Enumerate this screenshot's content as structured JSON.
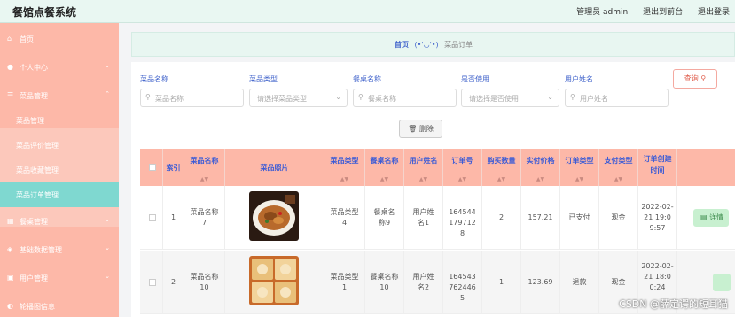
{
  "app": {
    "title": "餐馆点餐系统"
  },
  "topbar": {
    "user": "管理员 admin",
    "front": "退出到前台",
    "logout": "退出登录"
  },
  "sidebar": {
    "items": [
      {
        "label": "首页",
        "icon": "home-icon"
      },
      {
        "label": "个人中心",
        "icon": "user-icon"
      },
      {
        "label": "菜品管理",
        "icon": "menu-icon"
      },
      {
        "label": "餐桌管理",
        "icon": "table-icon"
      },
      {
        "label": "基础数据管理",
        "icon": "database-icon"
      },
      {
        "label": "用户管理",
        "icon": "users-icon"
      },
      {
        "label": "轮播图信息",
        "icon": "image-icon"
      }
    ],
    "subitems": [
      {
        "label": "菜品管理"
      },
      {
        "label": "菜品评价管理"
      },
      {
        "label": "菜品收藏管理"
      },
      {
        "label": "菜品订单管理"
      }
    ]
  },
  "breadcrumb": {
    "home": "首页",
    "emoji": "(•'◡'•)",
    "current": "菜品订单"
  },
  "filters": {
    "dish_name": {
      "label": "菜品名称",
      "placeholder": "菜品名称"
    },
    "dish_type": {
      "label": "菜品类型",
      "placeholder": "请选择菜品类型"
    },
    "table_name": {
      "label": "餐桌名称",
      "placeholder": "餐桌名称"
    },
    "in_use": {
      "label": "是否使用",
      "placeholder": "请选择是否使用"
    },
    "user_name": {
      "label": "用户姓名",
      "placeholder": "用户姓名"
    }
  },
  "buttons": {
    "query": "查询",
    "delete": "删除",
    "detail": "详情"
  },
  "table": {
    "headers": {
      "index": "索引",
      "dish_name": "菜品名称",
      "photo": "菜品照片",
      "dish_type": "菜品类型",
      "table_name": "餐桌名称",
      "user_name": "用户姓名",
      "order_no": "订单号",
      "qty": "购买数量",
      "price": "实付价格",
      "order_type": "订单类型",
      "pay_type": "支付类型",
      "created": "订单创建时间"
    },
    "rows": [
      {
        "index": "1",
        "dish_name": "菜品名称7",
        "dish_type": "菜品类型4",
        "table_name": "餐桌名称9",
        "user_name": "用户姓名1",
        "order_no": "1645441797128",
        "qty": "2",
        "price": "157.21",
        "order_type": "已支付",
        "pay_type": "现金",
        "created": "2022-02-21 19:09:57",
        "photo": "dish-photo-noodles"
      },
      {
        "index": "2",
        "dish_name": "菜品名称10",
        "dish_type": "菜品类型1",
        "table_name": "餐桌名称10",
        "user_name": "用户姓名2",
        "order_no": "1645437624465",
        "qty": "1",
        "price": "123.69",
        "order_type": "退款",
        "pay_type": "现金",
        "created": "2022-02-21 18:00:24",
        "photo": "dish-photo-dumplings"
      }
    ]
  },
  "watermark": "CSDN @薛定谔的短耳猫",
  "colors": {
    "sidebar": "#fdb8a8",
    "active": "#7fd8d0",
    "header_text": "#3b5bd6",
    "topbar": "#e9f7f2"
  }
}
